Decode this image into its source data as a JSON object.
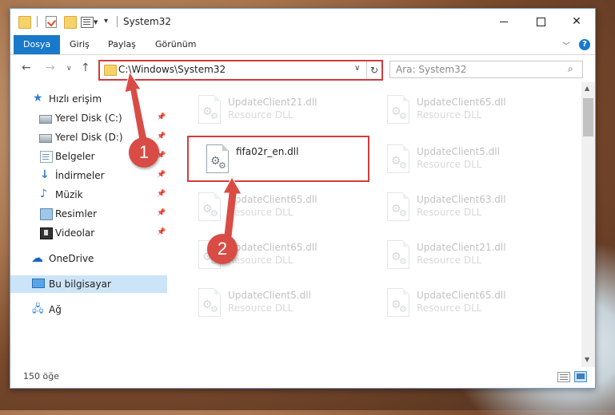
{
  "window": {
    "title": "System32"
  },
  "ribbon": {
    "tabs": [
      "Dosya",
      "Giriş",
      "Paylaş",
      "Görünüm"
    ],
    "help": "?"
  },
  "address": {
    "path": "C:\\Windows\\System32"
  },
  "search": {
    "placeholder": "Ara: System32"
  },
  "sidebar": {
    "items": [
      {
        "label": "Hızlı erişim",
        "icon": "star-icon"
      },
      {
        "label": "Yerel Disk (C:)",
        "icon": "drive-icon"
      },
      {
        "label": "Yerel Disk (D:)",
        "icon": "drive-icon"
      },
      {
        "label": "Belgeler",
        "icon": "documents-icon"
      },
      {
        "label": "İndirmeler",
        "icon": "download-icon"
      },
      {
        "label": "Müzik",
        "icon": "music-icon"
      },
      {
        "label": "Resimler",
        "icon": "pictures-icon"
      },
      {
        "label": "Videolar",
        "icon": "videos-icon"
      },
      {
        "label": "OneDrive",
        "icon": "cloud-icon"
      },
      {
        "label": "Bu bilgisayar",
        "icon": "computer-icon"
      },
      {
        "label": "Ağ",
        "icon": "network-icon"
      }
    ]
  },
  "files": [
    {
      "name": "UpdateClient21.dll",
      "type": "Resource DLL"
    },
    {
      "name": "UpdateClient65.dll",
      "type": "Resource DLL"
    },
    {
      "name": "fifa02r_en.dll",
      "type": ""
    },
    {
      "name": "UpdateClient5.dll",
      "type": "Resource DLL"
    },
    {
      "name": "UpdateClient65.dll",
      "type": "Resource DLL"
    },
    {
      "name": "UpdateClient63.dll",
      "type": "Resource DLL"
    },
    {
      "name": "UpdateClient65.dll",
      "type": "Resource DLL"
    },
    {
      "name": "UpdateClient21.dll",
      "type": "Resource DLL"
    },
    {
      "name": "UpdateClient5.dll",
      "type": "Resource DLL"
    },
    {
      "name": "UpdateClient65.dll",
      "type": "Resource DLL"
    }
  ],
  "status": {
    "count": "150 öğe"
  },
  "annotations": {
    "step1": "1",
    "step2": "2",
    "color": "#d94c45"
  }
}
